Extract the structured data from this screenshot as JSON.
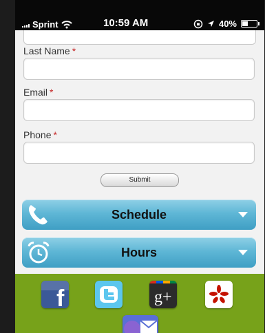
{
  "status_bar": {
    "carrier": "Sprint",
    "time": "10:59 AM",
    "battery": "40%",
    "battery_level": 0.4
  },
  "form": {
    "last_name_label": "Last Name",
    "email_label": "Email",
    "phone_label": "Phone",
    "required_mark": "*",
    "submit_label": "Submit"
  },
  "actions": {
    "schedule_label": "Schedule",
    "hours_label": "Hours"
  },
  "social": {
    "facebook_glyph": "f",
    "googleplus_glyph": "g+"
  },
  "colors": {
    "accent_bar": "#5fb7d6",
    "footer": "#77a21a",
    "required": "#c62828"
  }
}
